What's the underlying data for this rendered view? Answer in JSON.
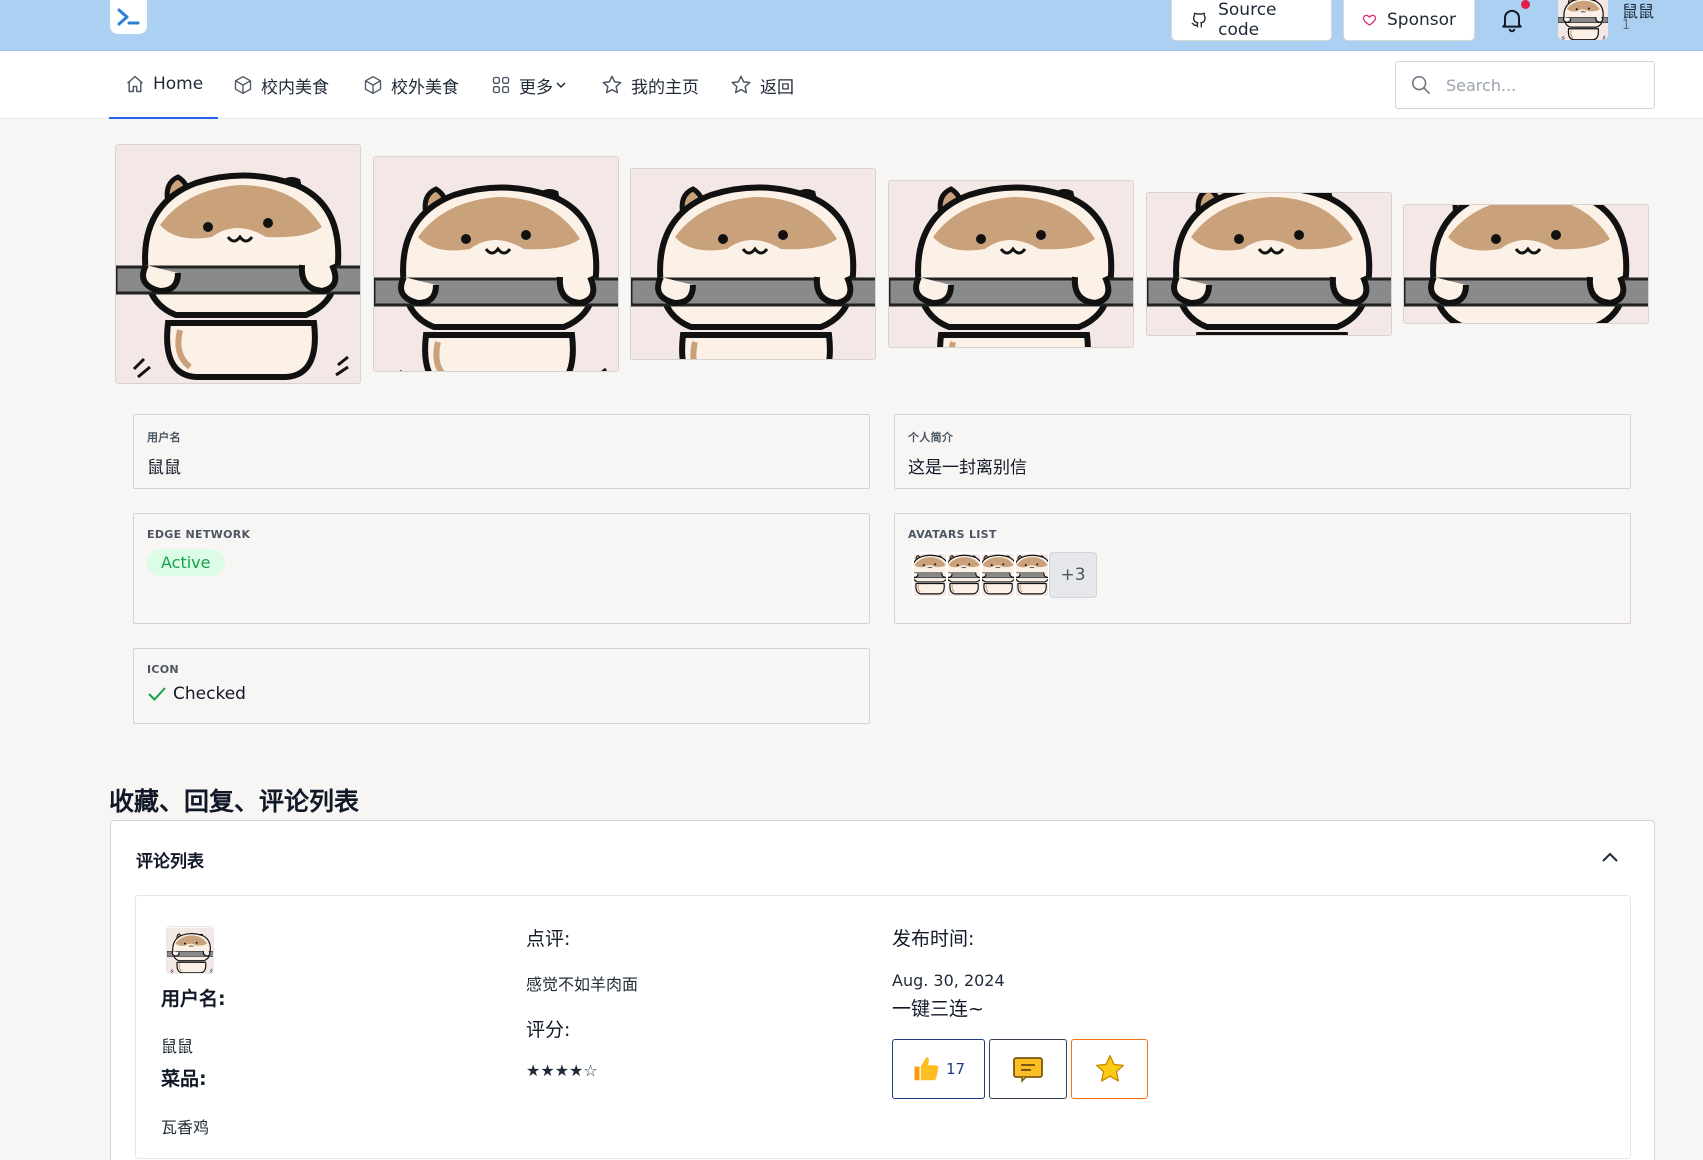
{
  "topbar": {
    "source_label": "Source code",
    "sponsor_label": "Sponsor",
    "user_name": "鼠鼠",
    "user_sub": "1"
  },
  "nav": {
    "items": [
      {
        "label": "Home",
        "icon": "home-icon",
        "active": true
      },
      {
        "label": "校内美食",
        "icon": "cube-icon"
      },
      {
        "label": "校外美食",
        "icon": "cube-icon"
      },
      {
        "label": "更多",
        "icon": "grid-icon",
        "dropdown": true
      },
      {
        "label": "我的主页",
        "icon": "star-icon"
      },
      {
        "label": "返回",
        "icon": "star-icon"
      }
    ],
    "search_placeholder": "Search..."
  },
  "profile": {
    "username_label": "用户名",
    "username_value": "鼠鼠",
    "bio_label": "个人简介",
    "bio_value": "这是一封离别信",
    "edge_label": "EDGE NETWORK",
    "edge_status": "Active",
    "avatars_label": "AVATARS LIST",
    "avatars_more": "+3",
    "icon_label": "ICON",
    "icon_value": "Checked"
  },
  "section_title": "收藏、回复、评论列表",
  "comments_panel": {
    "title": "评论列表",
    "comment": {
      "username_label": "用户名:",
      "username_value": "鼠鼠",
      "dish_label": "菜品:",
      "dish_value": "瓦香鸡",
      "review_label": "点评:",
      "review_value": "感觉不如羊肉面",
      "rating_label": "评分:",
      "rating_value": "★★★★☆",
      "time_label": "发布时间:",
      "time_value": "Aug. 30, 2024",
      "triple_label": "一键三连~",
      "like_count": "17"
    }
  },
  "colors": {
    "topbar": "#abd0f2",
    "accent": "#2563eb",
    "active_badge_bg": "#dcfce7",
    "active_badge_text": "#16a34a"
  }
}
